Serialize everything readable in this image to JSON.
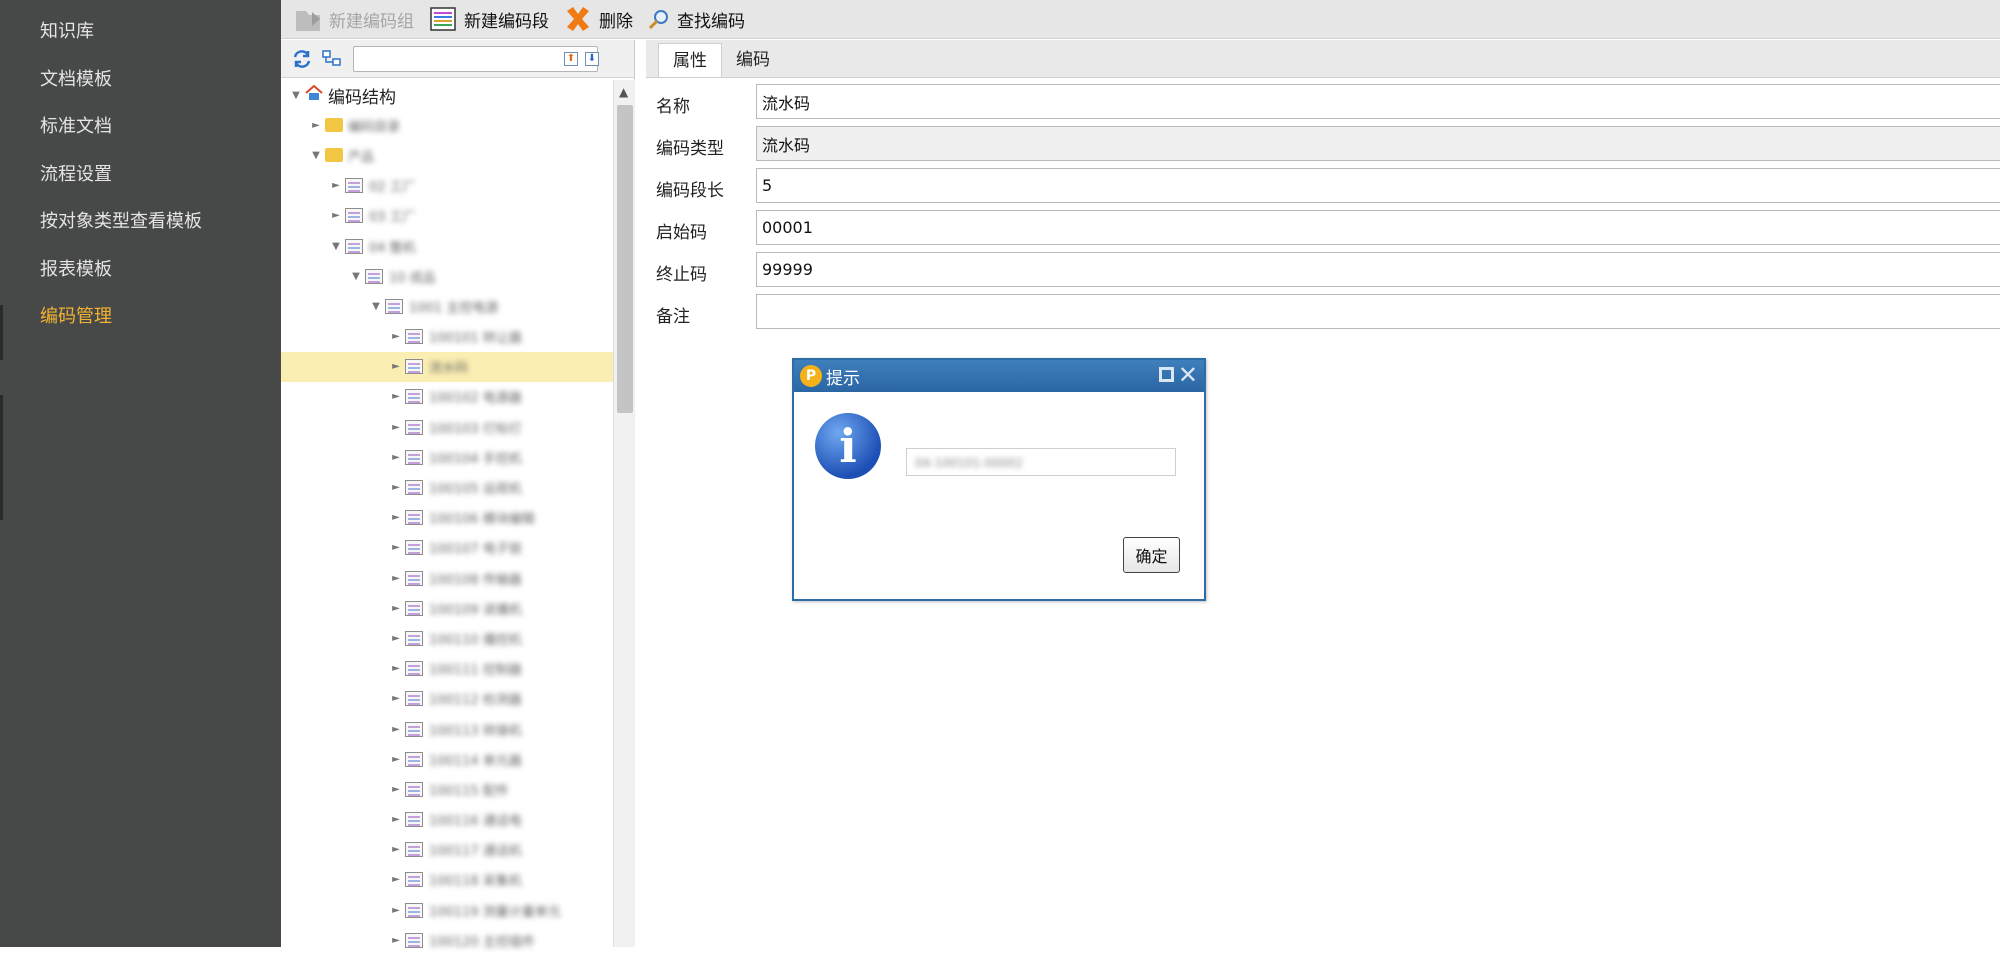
{
  "sidebar": {
    "items": [
      {
        "label": "知识库",
        "active": false
      },
      {
        "label": "文档模板",
        "active": false
      },
      {
        "label": "标准文档",
        "active": false
      },
      {
        "label": "流程设置",
        "active": false
      },
      {
        "label": "按对象类型查看模板",
        "active": false
      },
      {
        "label": "报表模板",
        "active": false
      },
      {
        "label": "编码管理",
        "active": true
      }
    ],
    "active_color": "#f2b233"
  },
  "toolbar": {
    "new_group_label": "新建编码组",
    "new_segment_label": "新建编码段",
    "delete_label": "删除",
    "find_label": "查找编码"
  },
  "tree": {
    "search_placeholder": "",
    "root_label": "编码结构",
    "nodes": [
      {
        "depth": 1,
        "type": "folder",
        "expanded": false,
        "label": "编码目录",
        "selected": false
      },
      {
        "depth": 1,
        "type": "folder",
        "expanded": true,
        "label": "产品",
        "selected": false
      },
      {
        "depth": 2,
        "type": "doc",
        "expanded": false,
        "label": "02 工厂",
        "selected": false
      },
      {
        "depth": 2,
        "type": "doc",
        "expanded": false,
        "label": "03 工厂",
        "selected": false
      },
      {
        "depth": 2,
        "type": "doc",
        "expanded": true,
        "label": "04 整机",
        "selected": false
      },
      {
        "depth": 3,
        "type": "doc",
        "expanded": true,
        "label": "10 成品",
        "selected": false
      },
      {
        "depth": 4,
        "type": "doc",
        "expanded": true,
        "label": "1001 主控电源",
        "selected": false
      },
      {
        "depth": 5,
        "type": "doc",
        "expanded": false,
        "label": "100101 转让器",
        "selected": false
      },
      {
        "depth": 5,
        "type": "doc",
        "expanded": false,
        "label": "流水码",
        "selected": true
      },
      {
        "depth": 5,
        "type": "doc",
        "expanded": false,
        "label": "100102 电源器",
        "selected": false
      },
      {
        "depth": 5,
        "type": "doc",
        "expanded": false,
        "label": "100103 灯标灯",
        "selected": false
      },
      {
        "depth": 5,
        "type": "doc",
        "expanded": false,
        "label": "100104 手控机",
        "selected": false
      },
      {
        "depth": 5,
        "type": "doc",
        "expanded": false,
        "label": "100105 运荷机",
        "selected": false
      },
      {
        "depth": 5,
        "type": "doc",
        "expanded": false,
        "label": "100106 模块编辑",
        "selected": false
      },
      {
        "depth": 5,
        "type": "doc",
        "expanded": false,
        "label": "100107 电子锁",
        "selected": false
      },
      {
        "depth": 5,
        "type": "doc",
        "expanded": false,
        "label": "100108 传输器",
        "selected": false
      },
      {
        "depth": 5,
        "type": "doc",
        "expanded": false,
        "label": "100109 读播机",
        "selected": false
      },
      {
        "depth": 5,
        "type": "doc",
        "expanded": false,
        "label": "100110 播控机",
        "selected": false
      },
      {
        "depth": 5,
        "type": "doc",
        "expanded": false,
        "label": "100111 控制器",
        "selected": false
      },
      {
        "depth": 5,
        "type": "doc",
        "expanded": false,
        "label": "100112 检测器",
        "selected": false
      },
      {
        "depth": 5,
        "type": "doc",
        "expanded": false,
        "label": "100113 转接机",
        "selected": false
      },
      {
        "depth": 5,
        "type": "doc",
        "expanded": false,
        "label": "100114 单元器",
        "selected": false
      },
      {
        "depth": 5,
        "type": "doc",
        "expanded": false,
        "label": "100115 配件",
        "selected": false
      },
      {
        "depth": 5,
        "type": "doc",
        "expanded": false,
        "label": "100116 通话电",
        "selected": false
      },
      {
        "depth": 5,
        "type": "doc",
        "expanded": false,
        "label": "100117 通话机",
        "selected": false
      },
      {
        "depth": 5,
        "type": "doc",
        "expanded": false,
        "label": "100118 采集机",
        "selected": false
      },
      {
        "depth": 5,
        "type": "doc",
        "expanded": false,
        "label": "100119 测量计量单元",
        "selected": false
      },
      {
        "depth": 5,
        "type": "doc",
        "expanded": false,
        "label": "100120 主控插件",
        "selected": false
      }
    ]
  },
  "tabs": [
    {
      "label": "属性",
      "active": true
    },
    {
      "label": "编码",
      "active": false
    }
  ],
  "form": {
    "name_label": "名称",
    "name_value": "流水码",
    "type_label": "编码类型",
    "type_value": "流水码",
    "length_label": "编码段长",
    "length_value": "5",
    "start_label": "启始码",
    "start_value": "00001",
    "end_label": "终止码",
    "end_value": "99999",
    "note_label": "备注",
    "note_value": ""
  },
  "dialog": {
    "title": "提示",
    "logo": "P",
    "message": "04-100101-00002",
    "ok_label": "确定",
    "icon": "info-icon"
  }
}
